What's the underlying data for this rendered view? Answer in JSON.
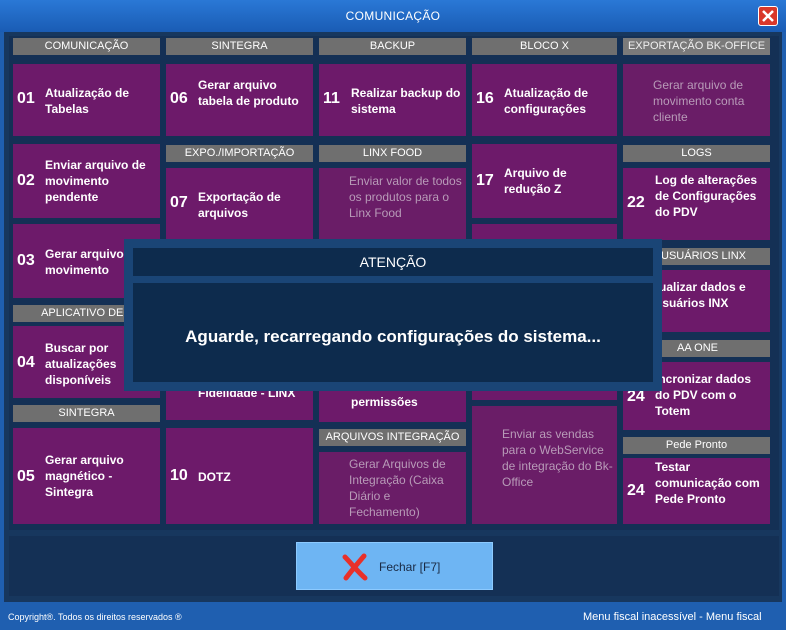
{
  "window": {
    "title": "COMUNICAÇÃO",
    "close_icon": "close-icon"
  },
  "headers": {
    "comunicacao": "COMUNICAÇÃO",
    "sintegra": "SINTEGRA",
    "backup": "BACKUP",
    "bloco_x": "BLOCO X",
    "exportacao_bkoffice": "EXPORTAÇÃO BK-OFFICE",
    "expo_importacao": "EXPO./IMPORTAÇÃO",
    "linx_food": "LINX FOOD",
    "logs": "LOGS",
    "aplicativo": "APLICATIVO DEG",
    "usuarios_linx": "USUÁRIOS LINX",
    "aa_one": "AA ONE",
    "sintegra2": "SINTEGRA",
    "arquivos_integracao": "ARQUIVOS INTEGRAÇÃO",
    "pede_pronto": "Pede Pronto"
  },
  "tiles": {
    "t01": {
      "num": "01",
      "label": "Atualização de Tabelas"
    },
    "t02": {
      "num": "02",
      "label": "Enviar arquivo de movimento pendente"
    },
    "t03": {
      "num": "03",
      "label": "Gerar arquivo de movimento"
    },
    "t04": {
      "num": "04",
      "label": "Buscar por atualizações disponíveis"
    },
    "t05": {
      "num": "05",
      "label": "Gerar arquivo magnético - Sintegra"
    },
    "t06": {
      "num": "06",
      "label": "Gerar arquivo tabela de produto"
    },
    "t07": {
      "num": "07",
      "label": "Exportação de arquivos"
    },
    "t09": {
      "num": "",
      "label": "Fidelidade - LINX"
    },
    "t10": {
      "num": "10",
      "label": "DOTZ"
    },
    "t11": {
      "num": "11",
      "label": "Realizar backup do sistema"
    },
    "t_linxfood": {
      "label": "Enviar valor de todos os produtos para o Linx Food"
    },
    "t_perm": {
      "label": "permissões"
    },
    "t_arqint": {
      "label": "Gerar Arquivos de Integração (Caixa Diário e Fechamento)"
    },
    "t16": {
      "num": "16",
      "label": "Atualização de configurações"
    },
    "t17": {
      "num": "17",
      "label": "Arquivo de redução Z"
    },
    "t_bkoffice_vendas": {
      "label": "Enviar as vendas para o WebService de integração do Bk-Office"
    },
    "t_bkoffice_mov": {
      "label": "Gerar arquivo de movimento conta cliente"
    },
    "t22": {
      "num": "22",
      "label": "Log de alterações de Configurações do PDV"
    },
    "t_usuarios": {
      "label": "tualizar dados e usuários INX"
    },
    "t24a": {
      "num": "24",
      "label": "incronizar dados do PDV com o Totem"
    },
    "t24b": {
      "num": "24",
      "label": "Testar comunicação com Pede Pronto"
    }
  },
  "modal": {
    "title": "ATENÇÃO",
    "message": "Aguarde, recarregando configurações do sistema..."
  },
  "bottom": {
    "fechar_label": "Fechar [F7]",
    "fechar_icon": "x-close-icon"
  },
  "footer": {
    "copyright": "Copyright®. Todos os direitos reservados ®",
    "menu_fiscal": "Menu fiscal inacessível - Menu fiscal"
  },
  "colors": {
    "tile": "#6d1a6a",
    "header": "#6f6f6f",
    "panel": "#143055",
    "titlebar": "#1f5fb0",
    "button": "#6eb5f3"
  }
}
